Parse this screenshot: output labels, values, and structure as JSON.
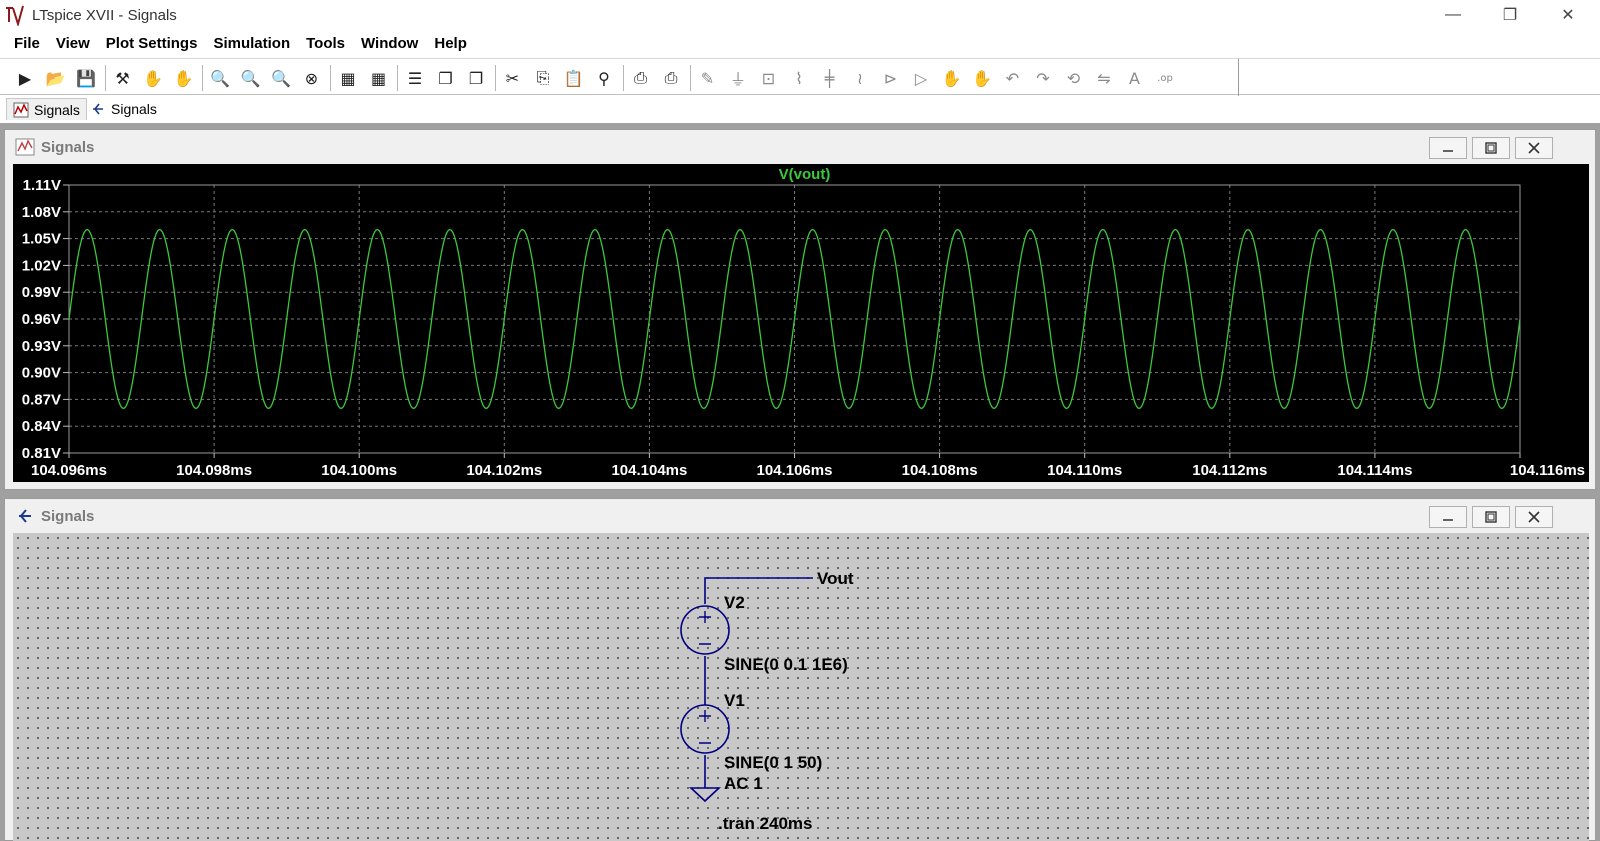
{
  "window": {
    "title": "LTspice XVII - Signals",
    "minimize_glyph": "—",
    "restore_glyph": "❐",
    "close_glyph": "✕"
  },
  "menu": [
    {
      "label": "File"
    },
    {
      "label": "View"
    },
    {
      "label": "Plot Settings"
    },
    {
      "label": "Simulation"
    },
    {
      "label": "Tools"
    },
    {
      "label": "Window"
    },
    {
      "label": "Help"
    }
  ],
  "toolbar": {
    "icons": [
      "run-icon",
      "open-icon",
      "save-icon",
      "control-panel-icon",
      "halt-icon",
      "pan-hand-icon",
      "zoom-area-icon",
      "zoom-in-icon",
      "zoom-out-icon",
      "zoom-cancel-icon",
      "autorange-icon",
      "manual-limits-icon",
      "tile-horizontal-icon",
      "cascade-icon",
      "tile-vertical-icon",
      "cut-icon",
      "copy-icon",
      "paste-icon",
      "find-icon",
      "print-icon",
      "print-preview-icon",
      "wire-icon",
      "ground-icon",
      "label-net-icon",
      "resistor-icon",
      "capacitor-icon",
      "inductor-icon",
      "diode-icon",
      "component-icon",
      "move-icon",
      "drag-icon",
      "undo-icon",
      "redo-icon",
      "rotate-icon",
      "mirror-icon",
      "text-icon",
      "spice-directive-icon"
    ]
  },
  "tabs": [
    {
      "label": "Signals",
      "icon": "waveform-tab-icon"
    },
    {
      "label": "Signals",
      "icon": "schematic-tab-icon"
    }
  ],
  "waveform_window": {
    "title": "Signals",
    "trace_color": "#3cc83c",
    "background_color": "#000000"
  },
  "schematic_window": {
    "title": "Signals",
    "net_label": "Vout",
    "v2_name": "V2",
    "v2_value": "SINE(0 0.1 1E6)",
    "v1_name": "V1",
    "v1_value": "SINE(0 1 50)",
    "v1_ac": "AC 1",
    "directive": ".tran 240ms",
    "wire_color": "#000080"
  },
  "chart_data": {
    "type": "line",
    "title": "V(vout)",
    "xlabel": "",
    "ylabel": "",
    "x_ticks": [
      "104.096ms",
      "104.098ms",
      "104.100ms",
      "104.102ms",
      "104.104ms",
      "104.106ms",
      "104.108ms",
      "104.110ms",
      "104.112ms",
      "104.114ms",
      "104.116ms"
    ],
    "y_ticks": [
      "1.11V",
      "1.08V",
      "1.05V",
      "1.02V",
      "0.99V",
      "0.96V",
      "0.93V",
      "0.90V",
      "0.87V",
      "0.84V",
      "0.81V"
    ],
    "xlim": [
      104.096,
      104.116
    ],
    "ylim": [
      0.81,
      1.11
    ],
    "grid": true,
    "series": [
      {
        "name": "V(vout)",
        "color": "#3cc83c",
        "function": "0.96 + 0.1*sin(2*pi*1E6*t)",
        "offset": 0.96,
        "amplitude": 0.1,
        "frequency_hz": 1000000,
        "cycles_visible": 20,
        "x": [
          104.096,
          104.0965,
          104.097,
          104.0975,
          104.098
        ],
        "y": [
          0.96,
          1.06,
          0.96,
          0.86,
          0.96
        ]
      }
    ]
  }
}
